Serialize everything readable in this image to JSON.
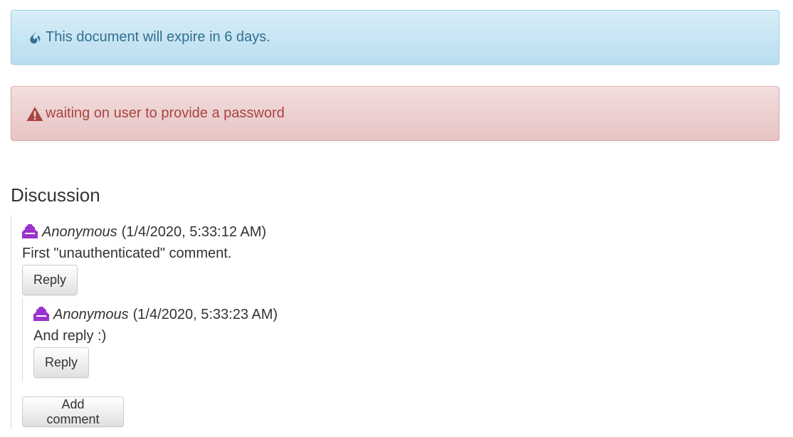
{
  "alerts": {
    "info_text": "This document will expire in 6 days.",
    "info_icon": "fire-icon",
    "danger_text": "waiting on user to provide a password",
    "danger_icon": "warning-triangle-icon"
  },
  "discussion": {
    "heading": "Discussion",
    "avatar_icon": "space-invader-avatar-icon",
    "avatar_color": "#9933cc",
    "comments": [
      {
        "author": "Anonymous",
        "timestamp": "(1/4/2020, 5:33:12 AM)",
        "body": "First \"unauthenticated\" comment.",
        "reply_label": "Reply",
        "replies": [
          {
            "author": "Anonymous",
            "timestamp": "(1/4/2020, 5:33:23 AM)",
            "body": "And reply :)",
            "reply_label": "Reply"
          }
        ]
      }
    ],
    "add_comment_label": "Add comment"
  }
}
